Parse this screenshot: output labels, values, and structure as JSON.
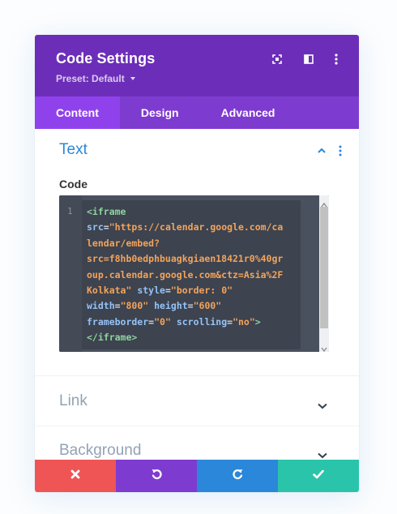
{
  "modal": {
    "title": "Code Settings",
    "preset_label": "Preset: Default",
    "header_icons": [
      "fullscreen-icon",
      "sidebar-toggle-icon",
      "kebab-menu-icon"
    ]
  },
  "tabs": [
    {
      "label": "Content",
      "active": true
    },
    {
      "label": "Design",
      "active": false
    },
    {
      "label": "Advanced",
      "active": false
    }
  ],
  "sections": {
    "text": {
      "title": "Text",
      "expanded": true
    },
    "link": {
      "title": "Link",
      "expanded": false
    },
    "background": {
      "title": "Background",
      "expanded": false
    }
  },
  "code_field": {
    "label": "Code",
    "line_number": "1",
    "lines": [
      [
        {
          "t": "tag",
          "v": "<iframe"
        }
      ],
      [
        {
          "t": "attr",
          "v": "src"
        },
        {
          "t": "punc",
          "v": "="
        },
        {
          "t": "str",
          "v": "\"https://calendar.google.com/ca"
        }
      ],
      [
        {
          "t": "str",
          "v": "lendar/embed?"
        }
      ],
      [
        {
          "t": "str",
          "v": "src=f8hb0edphbuagkgiaen18421r0%40gr"
        }
      ],
      [
        {
          "t": "str",
          "v": "oup.calendar.google.com&ctz=Asia%2F"
        }
      ],
      [
        {
          "t": "str",
          "v": "Kolkata\""
        },
        {
          "t": "punc",
          "v": " "
        },
        {
          "t": "attr",
          "v": "style"
        },
        {
          "t": "punc",
          "v": "="
        },
        {
          "t": "str",
          "v": "\"border: 0\""
        }
      ],
      [
        {
          "t": "attr",
          "v": "width"
        },
        {
          "t": "punc",
          "v": "="
        },
        {
          "t": "str",
          "v": "\"800\""
        },
        {
          "t": "punc",
          "v": " "
        },
        {
          "t": "attr",
          "v": "height"
        },
        {
          "t": "punc",
          "v": "="
        },
        {
          "t": "str",
          "v": "\"600\""
        }
      ],
      [
        {
          "t": "attr",
          "v": "frameborder"
        },
        {
          "t": "punc",
          "v": "="
        },
        {
          "t": "str",
          "v": "\"0\""
        },
        {
          "t": "punc",
          "v": " "
        },
        {
          "t": "attr",
          "v": "scrolling"
        },
        {
          "t": "punc",
          "v": "="
        },
        {
          "t": "str",
          "v": "\"no\""
        },
        {
          "t": "tag",
          "v": ">"
        }
      ],
      [
        {
          "t": "tag",
          "v": "</iframe>"
        }
      ]
    ]
  },
  "footer": [
    {
      "name": "discard-button",
      "icon": "close-icon",
      "color": "#ef5555"
    },
    {
      "name": "undo-button",
      "icon": "undo-icon",
      "color": "#7e3bd0"
    },
    {
      "name": "redo-button",
      "icon": "redo-icon",
      "color": "#2b87da"
    },
    {
      "name": "save-button",
      "icon": "check-icon",
      "color": "#29c4a9"
    }
  ],
  "colors": {
    "header_bg": "#6c2eb9",
    "tabs_bg": "#7e3bd0",
    "active_tab_bg": "#8f42ec",
    "accent_blue": "#2b87da",
    "code_bg": "#4a515e"
  }
}
